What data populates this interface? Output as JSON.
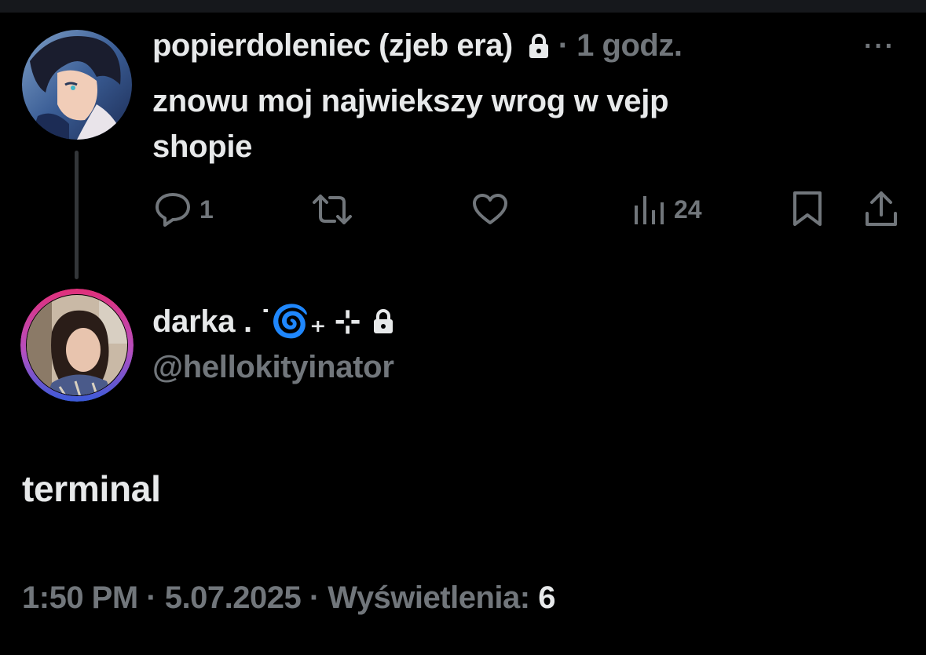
{
  "reply": {
    "display_name": "popierdoleniec (zjeb era)",
    "time": "· 1 godz.",
    "more_label": "···",
    "text_line1": "znowu moj najwiekszy wrog w vejp",
    "text_line2": "shopie",
    "actions": {
      "reply_count": "1",
      "repost_count": "",
      "like_count": "",
      "views_count": "24"
    }
  },
  "main": {
    "display_name": "darka . ˙🌀₊ ⊹",
    "handle": "@hellokityinator",
    "text": "terminal",
    "time": "1:50 PM",
    "date": "5.07.2025",
    "views_label": "Wyświetlenia:",
    "views_count": "6",
    "separator": "·"
  },
  "colors": {
    "background": "#000000",
    "text_primary": "#e7e9ea",
    "text_secondary": "#71767b",
    "thread_line": "#333639",
    "avatar_ring_top": "#e0307a",
    "avatar_ring_bottom": "#3a5bd9"
  },
  "icons": {
    "lock": "lock-icon",
    "reply": "comment-bubble-icon",
    "repost": "repost-arrows-icon",
    "like": "heart-icon",
    "views": "bar-chart-icon",
    "bookmark": "bookmark-icon",
    "share": "share-upload-icon"
  }
}
